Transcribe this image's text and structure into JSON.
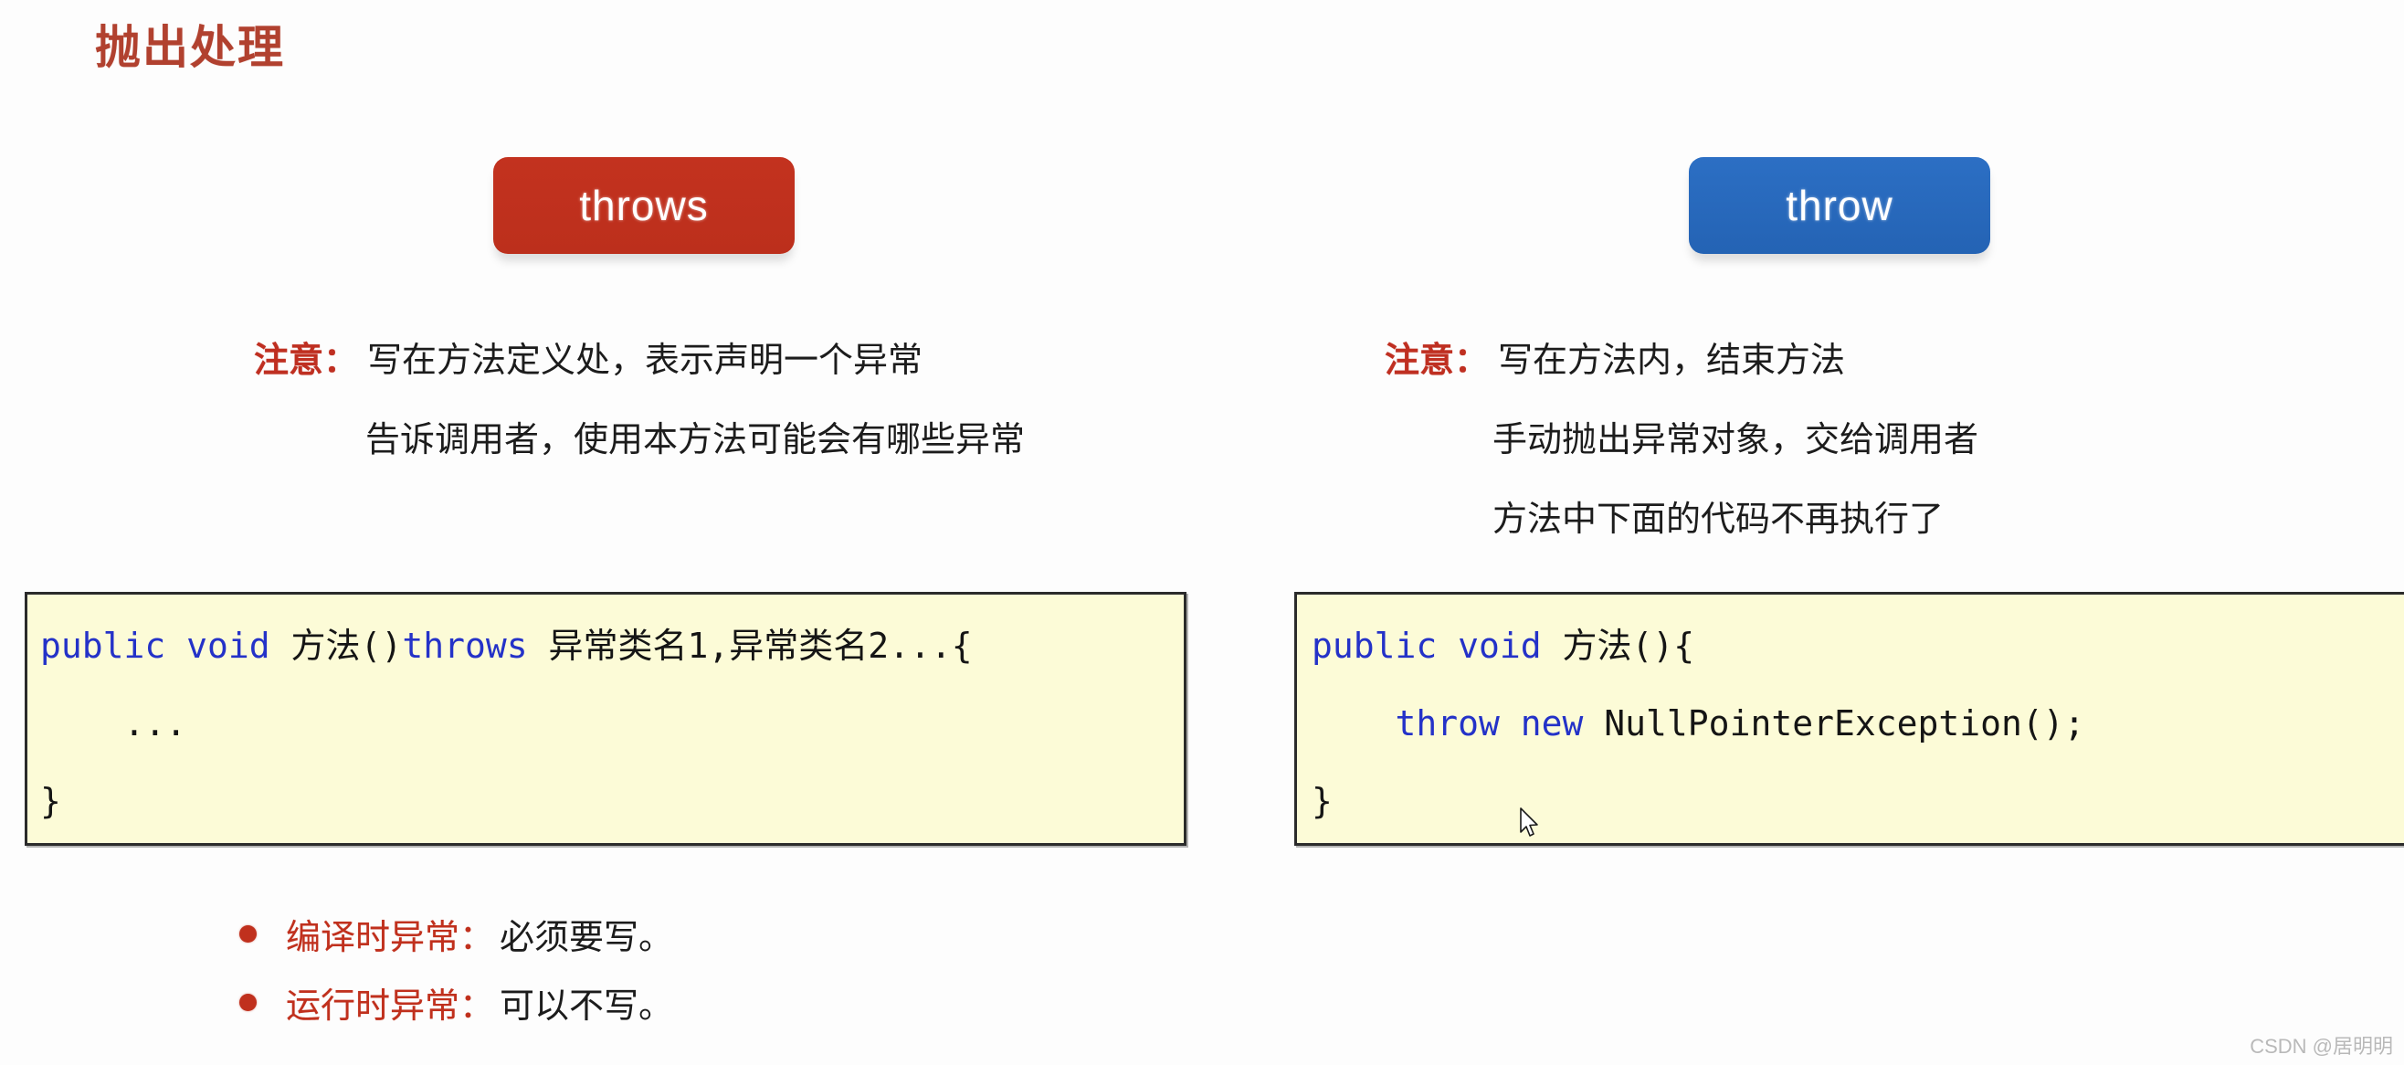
{
  "slide": {
    "title": "抛出处理",
    "title_color": "#b1412f",
    "background": "#fdfdfd"
  },
  "buttons": [
    {
      "id": "throws",
      "label": "throws",
      "color": "#c0301d",
      "text_color": "#ffffff"
    },
    {
      "id": "throw",
      "label": "throw",
      "color": "#2769bd",
      "text_color": "#ffffff"
    }
  ],
  "notes": {
    "left": {
      "label": "注意：",
      "label_color": "#bf2f21",
      "lines": [
        "写在方法定义处，表示声明一个异常",
        "告诉调用者，使用本方法可能会有哪些异常"
      ]
    },
    "right": {
      "label": "注意：",
      "label_color": "#bf2f21",
      "lines": [
        "写在方法内，结束方法",
        "手动抛出异常对象，交给调用者",
        "方法中下面的代码不再执行了"
      ]
    }
  },
  "code_blocks": {
    "left": {
      "background": "#fcfbd7",
      "keyword_color": "#2432c8",
      "lines": [
        {
          "kw1": "public void ",
          "rest1": "方法()",
          "kw2": "throws",
          "rest2": " 异常类名1,异常类名2...{"
        },
        {
          "kw1": "",
          "rest1": "    ...",
          "kw2": "",
          "rest2": ""
        },
        {
          "kw1": "",
          "rest1": "}",
          "kw2": "",
          "rest2": ""
        }
      ]
    },
    "right": {
      "background": "#fcfbd7",
      "keyword_color": "#2432c8",
      "lines": [
        {
          "kw1": "public void ",
          "rest1": "方法(){",
          "kw2": "",
          "rest2": ""
        },
        {
          "kw1": "    throw new ",
          "rest1": "NullPointerException();",
          "kw2": "",
          "rest2": ""
        },
        {
          "kw1": "",
          "rest1": "}",
          "kw2": "",
          "rest2": ""
        }
      ]
    }
  },
  "bullets": [
    {
      "term": "编译时异常：",
      "desc": "必须要写。",
      "dot_color": "#c0301d"
    },
    {
      "term": "运行时异常：",
      "desc": "可以不写。",
      "dot_color": "#c0301d"
    }
  ],
  "watermark": "CSDN @居明明"
}
